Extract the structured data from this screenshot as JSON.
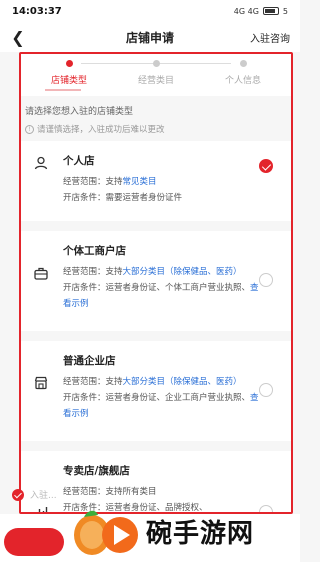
{
  "status_bar": {
    "time": "14:03:37",
    "network": "4G 4G",
    "battery": "5"
  },
  "header": {
    "title": "店铺申请",
    "consult": "入驻咨询"
  },
  "steps": [
    {
      "label": "店铺类型",
      "active": true
    },
    {
      "label": "经营类目",
      "active": false
    },
    {
      "label": "个人信息",
      "active": false
    }
  ],
  "intro": {
    "title": "请选择您想入驻的店铺类型",
    "hint": "请谨慎选择，入驻成功后难以更改"
  },
  "cards": [
    {
      "title": "个人店",
      "icon": "person-icon",
      "selected": true,
      "scope_label": "经营范围：",
      "scope_plain": "支持",
      "scope_highlight": "常见类目",
      "scope_tail": "",
      "cond_label": "开店条件：",
      "cond_text": "需要运营者身份证件",
      "cond_link": ""
    },
    {
      "title": "个体工商户店",
      "icon": "briefcase-icon",
      "selected": false,
      "scope_label": "经营范围：",
      "scope_plain": "支持",
      "scope_highlight": "大部分类目（除保健品、医药）",
      "scope_tail": "",
      "cond_label": "开店条件：",
      "cond_text": "运营者身份证、个体工商户营业执照、",
      "cond_link": "查看示例"
    },
    {
      "title": "普通企业店",
      "icon": "store-icon",
      "selected": false,
      "scope_label": "经营范围：",
      "scope_plain": "支持",
      "scope_highlight": "大部分类目（除保健品、医药）",
      "scope_tail": "",
      "cond_label": "开店条件：",
      "cond_text": "运营者身份证、企业工商户营业执照、",
      "cond_link": "查看示例"
    },
    {
      "title": "专卖店/旗舰店",
      "icon": "chart-icon",
      "selected": false,
      "scope_label": "经营范围：",
      "scope_plain": "支持所有类目",
      "scope_highlight": "",
      "scope_tail": "",
      "cond_label": "开店条件：",
      "cond_text": "运营者身份证、品牌授权、",
      "cond_link": ""
    }
  ],
  "agreement": {
    "text": "入驻..."
  },
  "watermark": {
    "text": "碗手游网"
  },
  "colors": {
    "accent": "#e3242b",
    "link": "#2a6fd6"
  }
}
